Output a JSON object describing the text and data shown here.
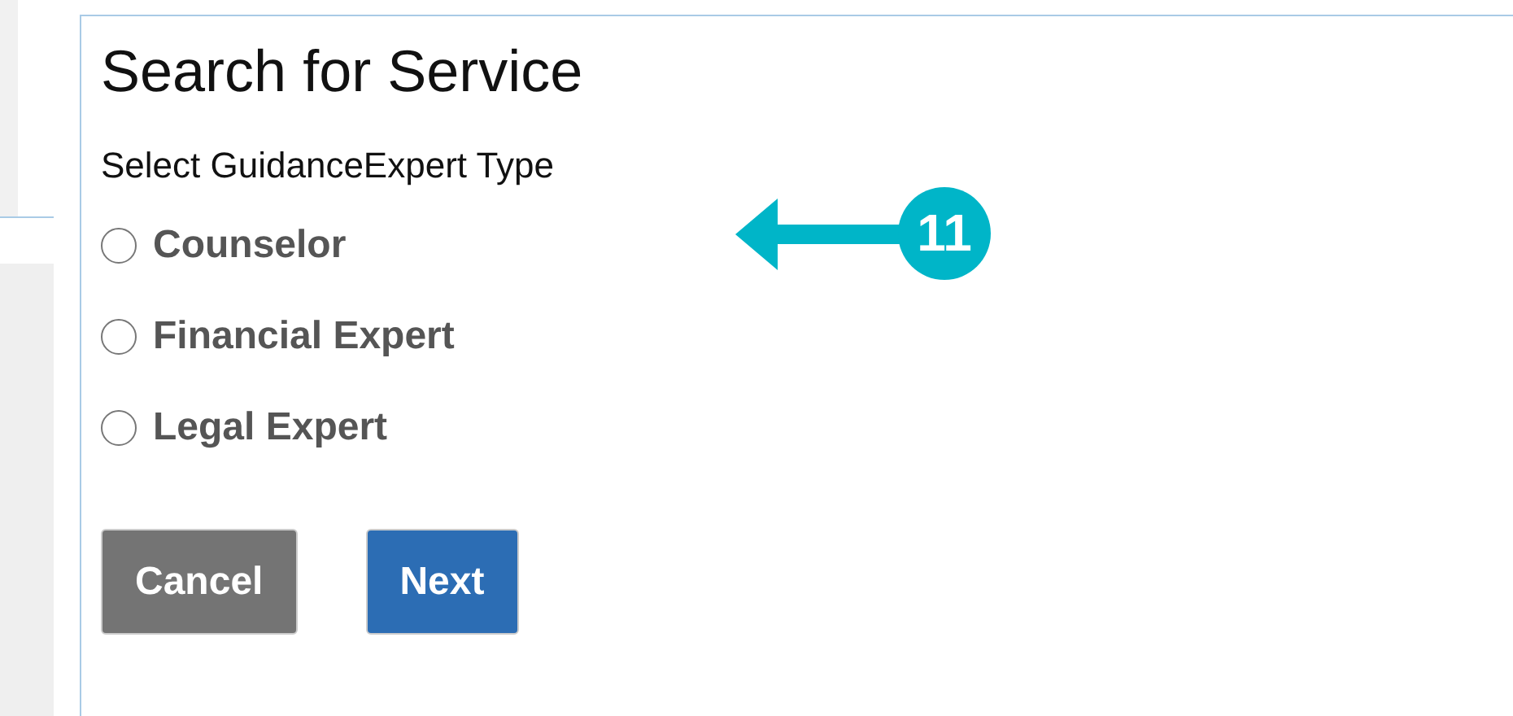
{
  "title": "Search for Service",
  "prompt": "Select GuidanceExpert Type",
  "options": [
    {
      "label": "Counselor",
      "selected": false
    },
    {
      "label": "Financial Expert",
      "selected": false
    },
    {
      "label": "Legal Expert",
      "selected": false
    }
  ],
  "buttons": [
    {
      "label": "Cancel",
      "kind": "secondary"
    },
    {
      "label": "Next",
      "kind": "primary"
    }
  ],
  "callout": {
    "label": "11"
  }
}
